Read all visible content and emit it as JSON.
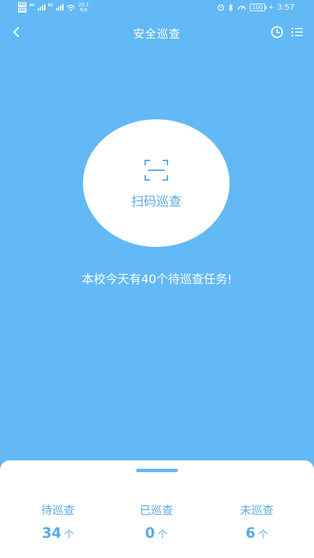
{
  "status_bar": {
    "hd1": "HD",
    "hd2": "HD",
    "net1": "4G",
    "net2": "5G",
    "speed_value": "20.1",
    "speed_unit": "K/s",
    "battery": "100",
    "time": "3:57"
  },
  "nav": {
    "title": "安全巡查"
  },
  "scan": {
    "label": "扫码巡查"
  },
  "task_message": "本校今天有40个待巡查任务!",
  "stats": [
    {
      "label": "待巡查",
      "value": "34",
      "unit": "个"
    },
    {
      "label": "已巡查",
      "value": "0",
      "unit": "个"
    },
    {
      "label": "未巡查",
      "value": "6",
      "unit": "个"
    }
  ],
  "colors": {
    "background": "#62b9f6",
    "accent": "#5aa9e6",
    "card": "#ffffff"
  },
  "icons": [
    "back-icon",
    "history-clock-icon",
    "list-menu-icon",
    "scan-frame-icon",
    "alarm-icon",
    "bluetooth-icon",
    "speedometer-icon",
    "wifi-icon",
    "signal-icon",
    "battery-icon"
  ]
}
